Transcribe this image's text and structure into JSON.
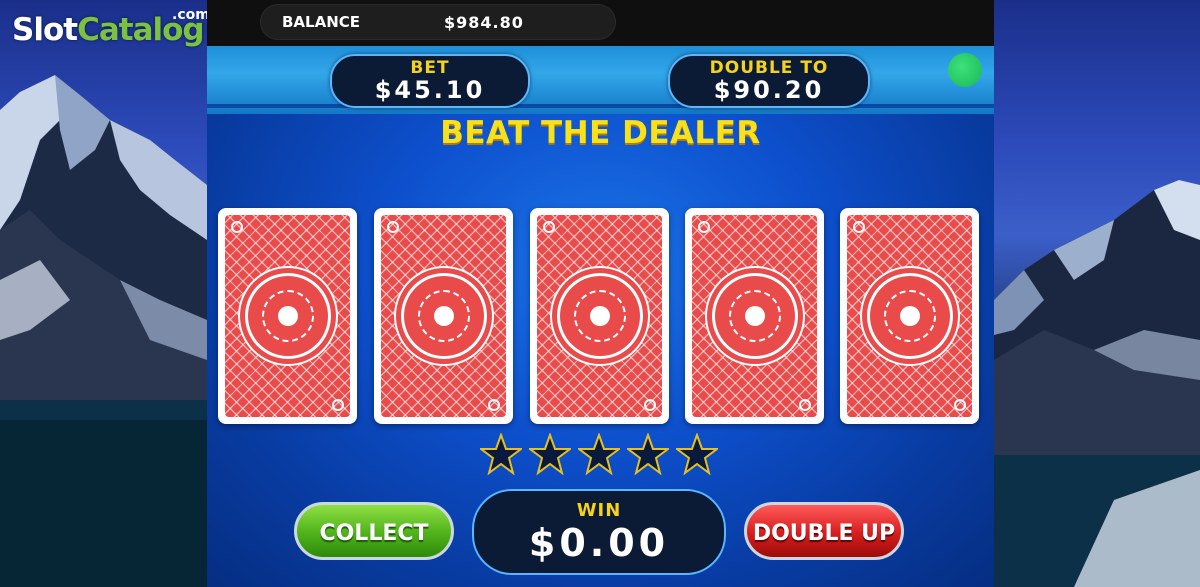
{
  "watermark": {
    "brand_part1": "Slot",
    "brand_part2": "Catalog",
    "suffix": ".com"
  },
  "balance": {
    "label": "BALANCE",
    "value": "$984.80"
  },
  "bet": {
    "label": "BET",
    "value": "$45.10"
  },
  "double_to": {
    "label": "DOUBLE TO",
    "value": "$90.20"
  },
  "status_indicator": {
    "color": "#1fc25e"
  },
  "headline": "BEAT THE DEALER",
  "cards": [
    {
      "face": "down",
      "icon": "card-back"
    },
    {
      "face": "down",
      "icon": "card-back"
    },
    {
      "face": "down",
      "icon": "card-back"
    },
    {
      "face": "down",
      "icon": "card-back"
    },
    {
      "face": "down",
      "icon": "card-back"
    }
  ],
  "progress_stars": {
    "total": 5,
    "filled": 0,
    "icon": "star-icon"
  },
  "buttons": {
    "collect": "COLLECT",
    "double_up": "DOUBLE UP"
  },
  "win": {
    "label": "WIN",
    "value": "$0.00"
  },
  "colors": {
    "accent_yellow": "#f7e11a",
    "collect_green": "#4fb21b",
    "double_red": "#d71d1d",
    "card_red": "#e94a4a"
  }
}
